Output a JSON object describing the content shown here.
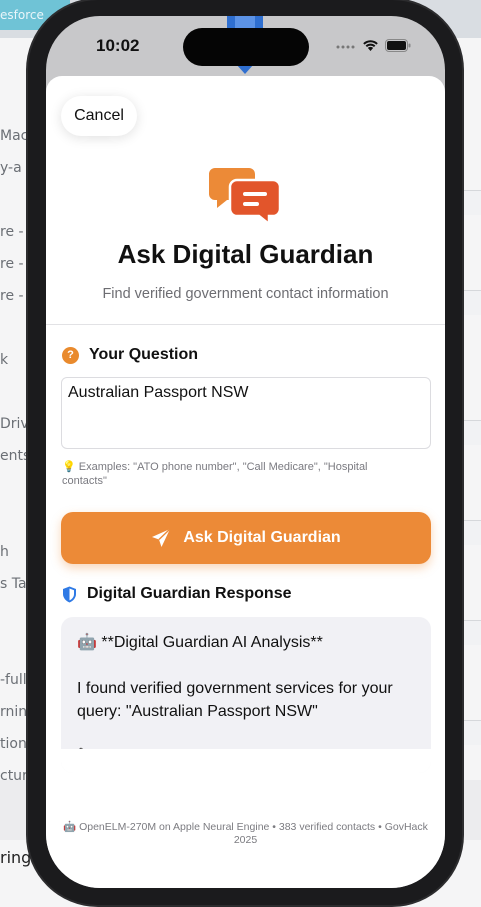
{
  "background": {
    "tab_label": "esforce",
    "side_items": [
      "Mac",
      "y-a",
      "re -",
      "re -",
      "re -",
      "k",
      "Drive",
      "ents",
      "h",
      "s Ta",
      "-fulls",
      "rning",
      "tions",
      "cture"
    ],
    "bottom_text": "ring"
  },
  "status_bar": {
    "time": "10:02",
    "icons": [
      "signal-icon",
      "wifi-icon",
      "battery-icon"
    ]
  },
  "sheet": {
    "cancel_label": "Cancel",
    "title": "Ask Digital Guardian",
    "subtitle": "Find verified government contact information",
    "question_badge": "?",
    "question_label": "Your Question",
    "question_value": "Australian Passport NSW",
    "examples_text": "Examples: \"ATO phone number\", \"Call Medicare\", \"Hospital contacts\"",
    "ask_button_label": "Ask Digital Guardian",
    "response_label": "Digital Guardian Response",
    "response_text": "🤖 **Digital Guardian AI Analysis**\n\nI found verified government services for your query: \"Australian Passport NSW\"\n\n📞 **Australian Passport Information Service (Telephone Service) Hours of",
    "footer_text": "🤖 OpenELM-270M on Apple Neural Engine • 383 verified contacts • GovHack 2025"
  },
  "colors": {
    "accent": "#ec8a37",
    "shield": "#2f7ae5",
    "chat_icon_back": "#ec8a37",
    "chat_icon_front": "#e2552b"
  }
}
